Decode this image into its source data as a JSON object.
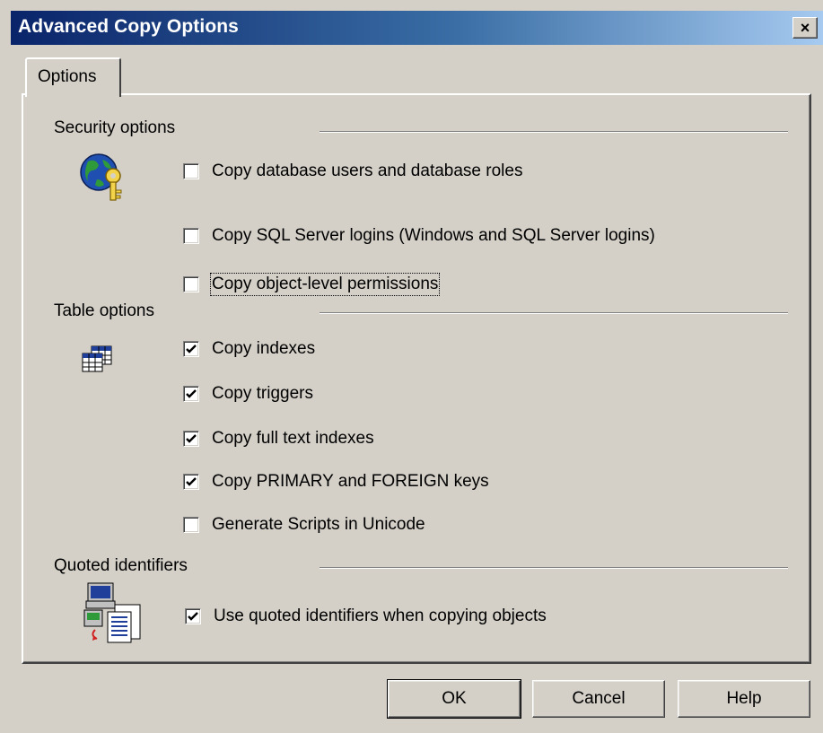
{
  "window": {
    "title": "Advanced Copy Options",
    "close_glyph": "×"
  },
  "tabs": [
    {
      "label": "Options",
      "selected": true
    }
  ],
  "sections": {
    "security": {
      "label": "Security options",
      "icon": "globe-key-icon",
      "options": [
        {
          "label": "Copy database users and database roles",
          "checked": false
        },
        {
          "label": "Copy SQL Server logins (Windows and SQL Server logins)",
          "checked": false
        },
        {
          "label": "Copy object-level permissions",
          "checked": false,
          "focused": true
        }
      ]
    },
    "table": {
      "label": "Table options",
      "icon": "table-icon",
      "options": [
        {
          "label": "Copy indexes",
          "checked": true
        },
        {
          "label": "Copy triggers",
          "checked": true
        },
        {
          "label": "Copy full text indexes",
          "checked": true
        },
        {
          "label": "Copy PRIMARY and FOREIGN keys",
          "checked": true
        },
        {
          "label": "Generate Scripts in Unicode",
          "checked": false
        }
      ]
    },
    "quoted": {
      "label": "Quoted identifiers",
      "icon": "computer-document-icon",
      "options": [
        {
          "label": "Use quoted identifiers when copying objects",
          "checked": true
        }
      ]
    }
  },
  "buttons": {
    "ok": "OK",
    "cancel": "Cancel",
    "help": "Help"
  },
  "colors": {
    "dialog_bg": "#d4d0c8",
    "title_start": "#0a246a",
    "title_end": "#a6caf0"
  }
}
